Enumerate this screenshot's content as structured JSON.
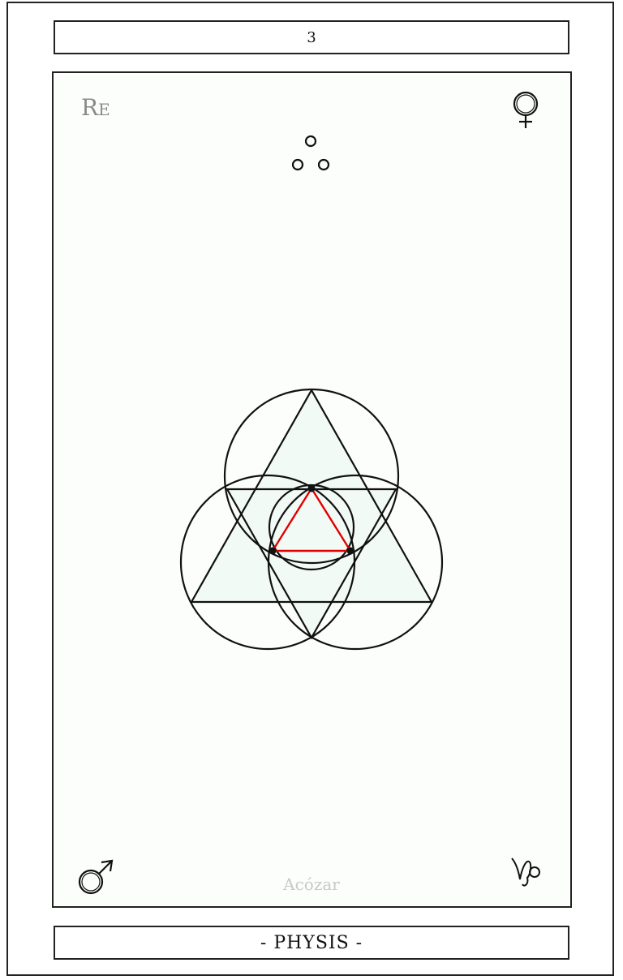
{
  "card": {
    "number": "3",
    "title": "- PHYSIS -",
    "signature": "Acózar",
    "corner_top_left": {
      "main": "R",
      "small": "E"
    },
    "corner_top_right_icon": "venus-symbol-icon",
    "corner_bottom_left_icon": "mars-symbol-icon",
    "corner_bottom_right_icon": "capricorn-symbol-icon",
    "top_ornament_icon": "three-dots-triangle-icon"
  },
  "colors": {
    "line": "#111111",
    "accent": "#e00000",
    "label_gray": "#8a8a8a",
    "signature_gray": "#c8c8c8",
    "panel_fill": "#fcfefc",
    "shape_fill": "#f2faf6"
  }
}
